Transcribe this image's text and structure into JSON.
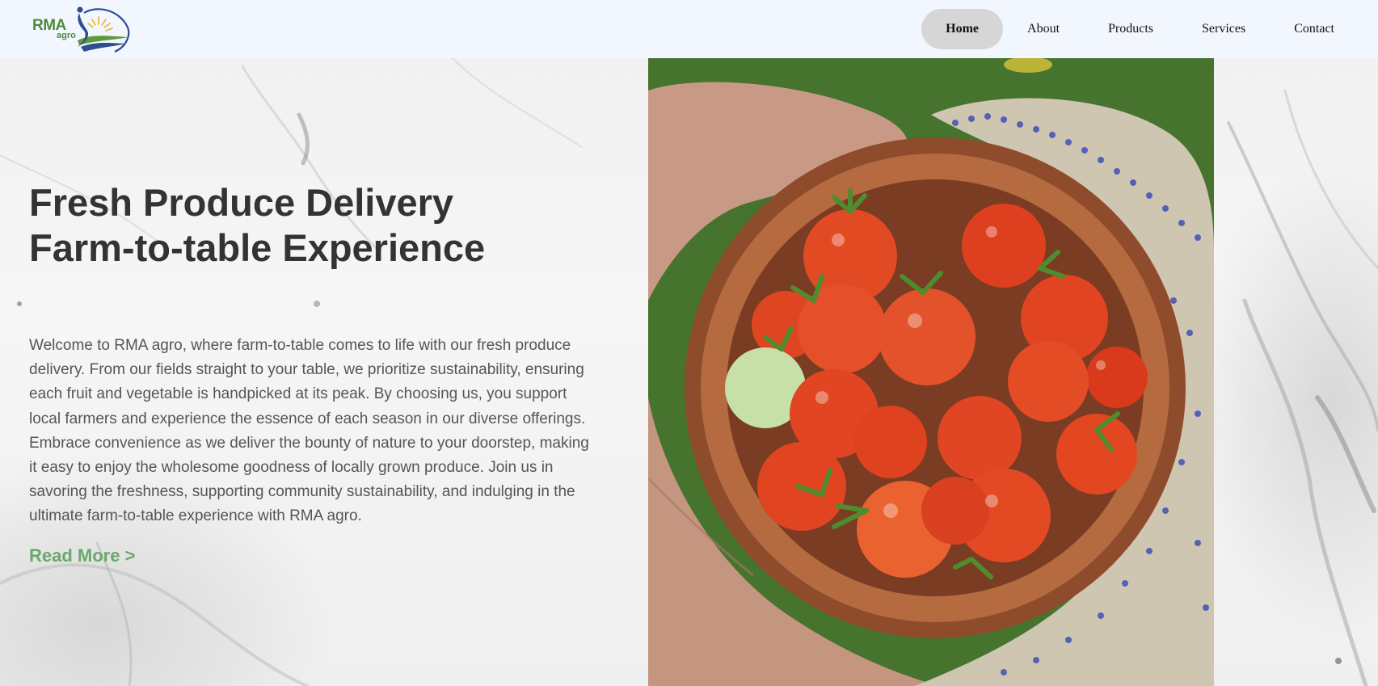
{
  "brand": {
    "logo_main": "RMA",
    "logo_sub": "agro"
  },
  "nav": {
    "items": [
      {
        "label": "Home",
        "active": true
      },
      {
        "label": "About",
        "active": false
      },
      {
        "label": "Products",
        "active": false
      },
      {
        "label": "Services",
        "active": false
      },
      {
        "label": "Contact",
        "active": false
      }
    ]
  },
  "hero": {
    "title_line1": "Fresh Produce Delivery",
    "title_line2": "Farm-to-table Experience",
    "body": "Welcome to RMA agro, where farm-to-table comes to life with our fresh produce delivery. From our fields straight to your table, we prioritize sustainability, ensuring each fruit and vegetable is handpicked at its peak. By choosing us, you support local farmers and experience the essence of each season in our diverse offerings. Embrace convenience as we deliver the bounty of nature to your doorstep, making it easy to enjoy the wholesome goodness of locally grown produce. Join us in savoring the freshness, supporting community sustainability, and indulging in the ultimate farm-to-table experience with RMA agro.",
    "read_more": "Read More >"
  },
  "colors": {
    "header_bg": "#f2f7ff",
    "accent_green": "#6aa86a",
    "title_text": "#333333",
    "body_text": "#555555",
    "nav_active_bg": "#d6d6d6"
  },
  "icons": {
    "logo": "rma-agro-logo-icon"
  }
}
